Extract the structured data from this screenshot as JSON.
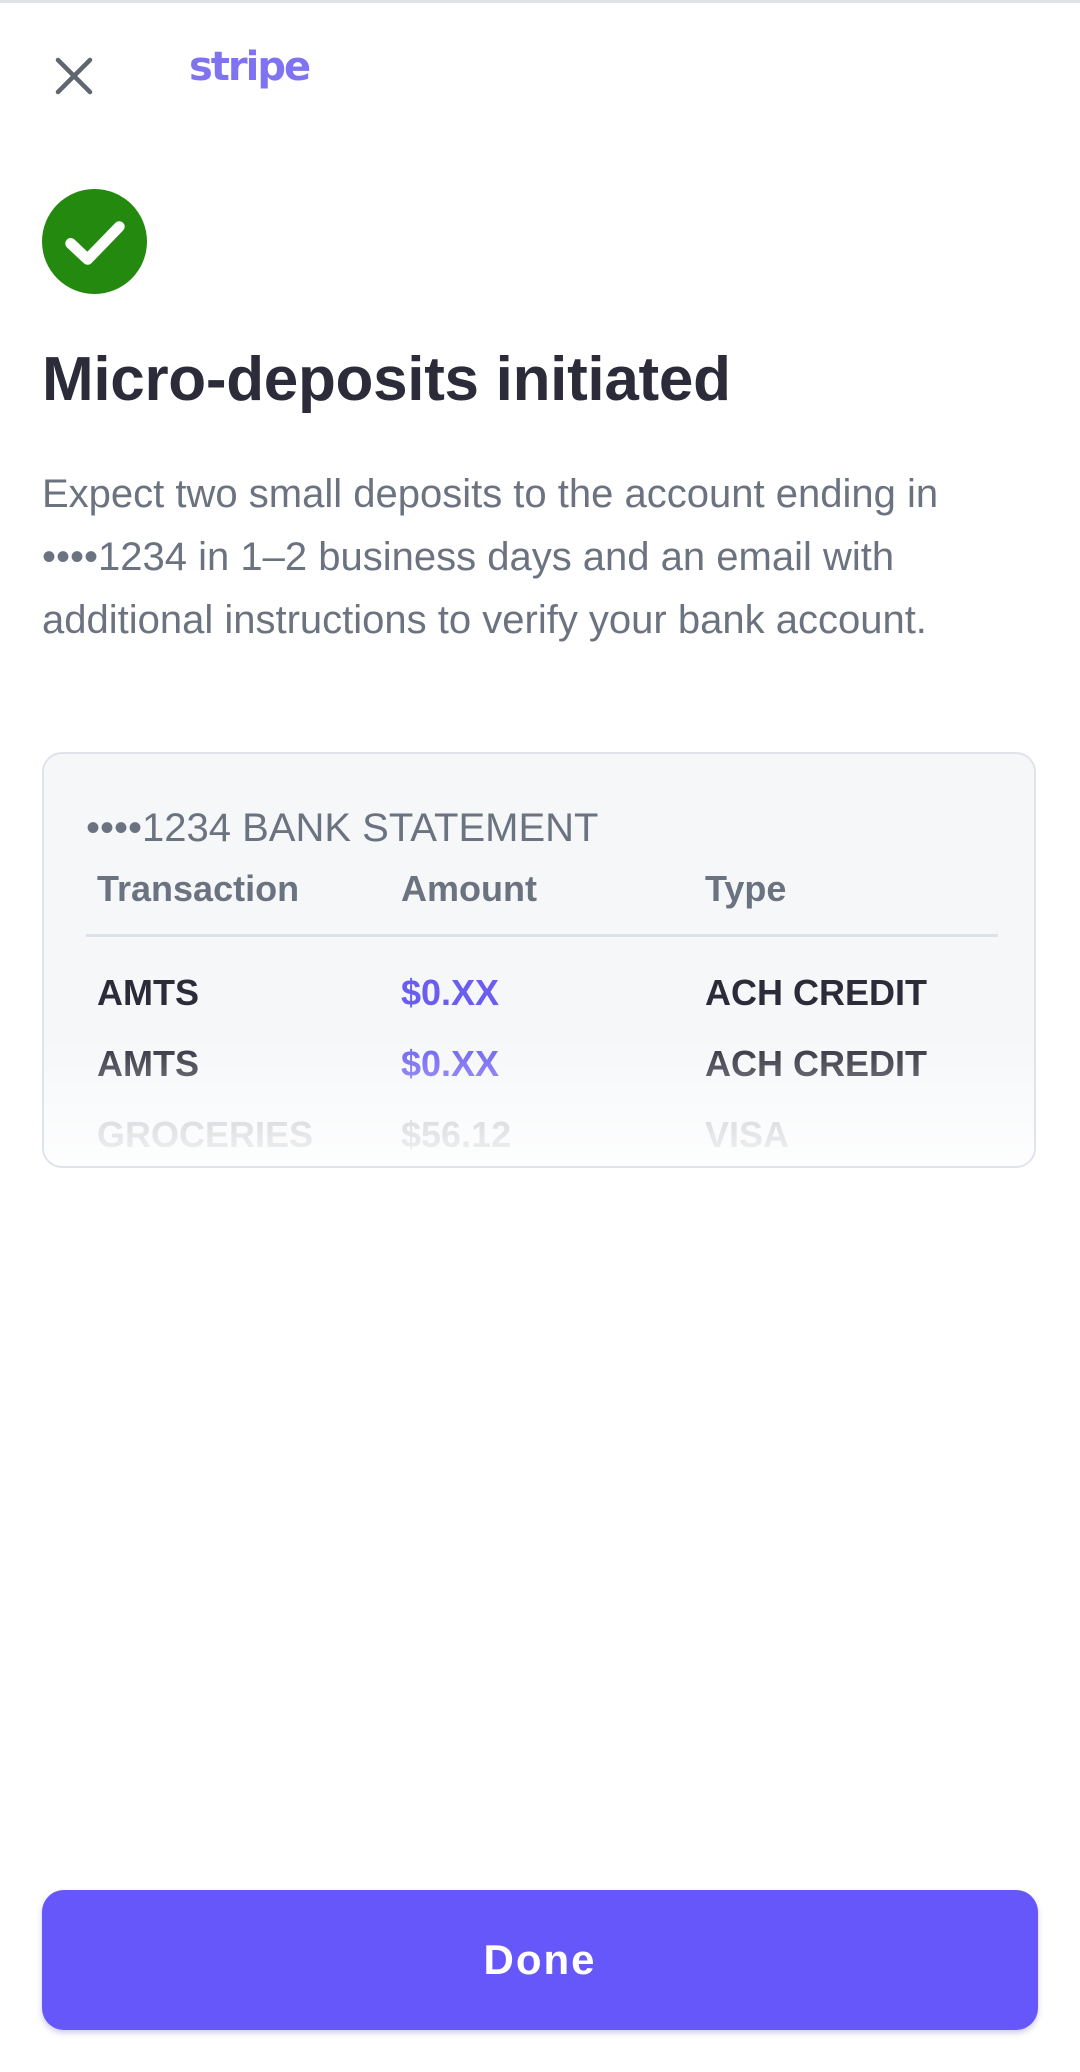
{
  "header": {
    "close_icon": "close-icon",
    "logo_text": "stripe",
    "brand_color": "#7f73f2"
  },
  "status": {
    "icon": "check-circle-icon",
    "color": "#24890f"
  },
  "title": "Micro-deposits initiated",
  "description": "Expect two small deposits to the account ending in ••••1234 in 1–2 business days and an email with additional instructions to verify your bank account.",
  "statement": {
    "title": "••••1234 BANK STATEMENT",
    "columns": [
      "Transaction",
      "Amount",
      "Type"
    ],
    "rows": [
      {
        "transaction": "AMTS",
        "amount": "$0.XX",
        "type": "ACH CREDIT"
      },
      {
        "transaction": "AMTS",
        "amount": "$0.XX",
        "type": "ACH CREDIT"
      },
      {
        "transaction": "GROCERIES",
        "amount": "$56.12",
        "type": "VISA"
      }
    ]
  },
  "actions": {
    "done_label": "Done",
    "accent_color": "#6557f9"
  }
}
